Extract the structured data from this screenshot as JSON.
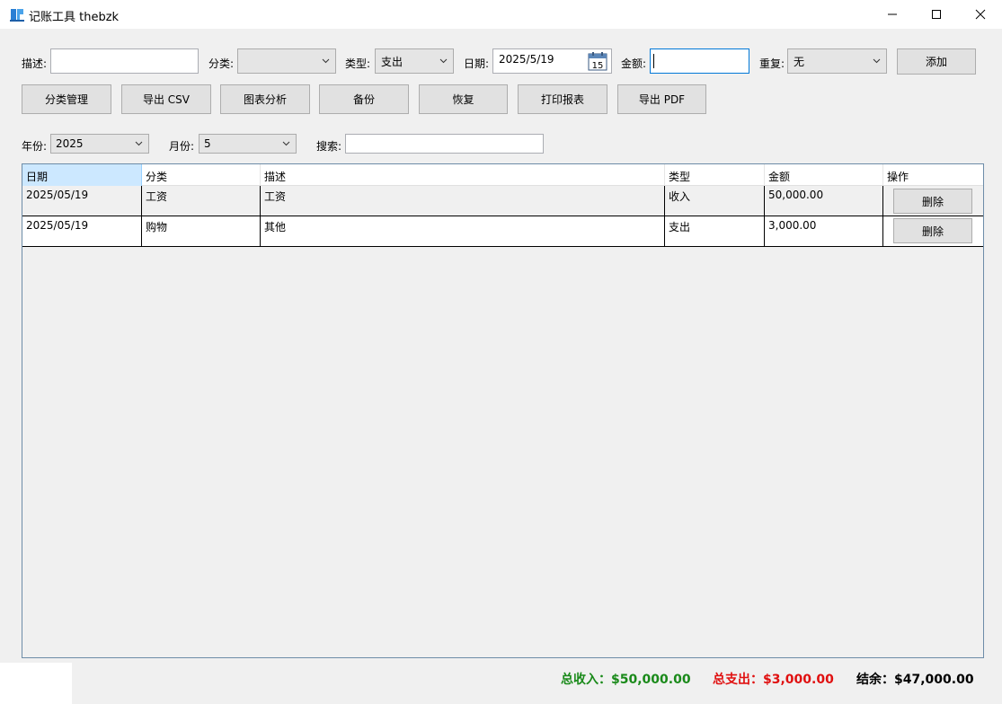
{
  "window": {
    "title": "记账工具  thebzk",
    "min_glyph": "—",
    "max_glyph": "☐",
    "close_glyph": "✕"
  },
  "form": {
    "desc_label": "描述:",
    "desc_value": "",
    "category_label": "分类:",
    "category_value": "",
    "type_label": "类型:",
    "type_value": "支出",
    "date_label": "日期:",
    "date_value": "2025/5/19",
    "calendar_day": "15",
    "amount_label": "金额:",
    "amount_value": "",
    "repeat_label": "重复:",
    "repeat_value": "无",
    "add_label": "添加"
  },
  "toolbar": {
    "category_manage": "分类管理",
    "export_csv": "导出 CSV",
    "chart_analysis": "图表分析",
    "backup": "备份",
    "restore": "恢复",
    "print_report": "打印报表",
    "export_pdf": "导出 PDF"
  },
  "filter": {
    "year_label": "年份:",
    "year_value": "2025",
    "month_label": "月份:",
    "month_value": "5",
    "search_label": "搜索:",
    "search_value": ""
  },
  "table": {
    "headers": [
      "日期",
      "分类",
      "描述",
      "类型",
      "金额",
      "操作"
    ],
    "rows": [
      {
        "date": "2025/05/19",
        "category": "工资",
        "desc": "工资",
        "type": "收入",
        "amount": "50,000.00",
        "action": "删除"
      },
      {
        "date": "2025/05/19",
        "category": "购物",
        "desc": "其他",
        "type": "支出",
        "amount": "3,000.00",
        "action": "删除"
      }
    ]
  },
  "summary": {
    "income": "总收入：$50,000.00",
    "expense": "总支出：$3,000.00",
    "balance": "结余：$47,000.00",
    "income_color": "#1a8a1a",
    "expense_color": "#e01010"
  }
}
